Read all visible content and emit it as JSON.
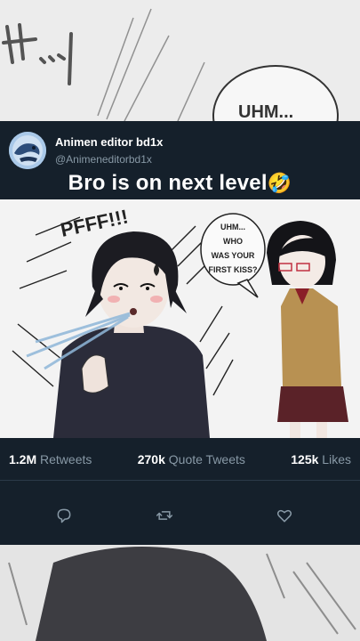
{
  "tweet": {
    "display_name": "Animen editor bd1x",
    "handle": "@Animeneditorbd1x",
    "caption": "Bro is on next level",
    "caption_emoji": "🤣"
  },
  "media": {
    "sfx_top": "PFFF!!!",
    "speech_bubble": [
      "UHM...",
      "WHO",
      "WAS YOUR",
      "FIRST KISS?"
    ],
    "bg_bubble": "UHM..."
  },
  "stats": {
    "retweets_count": "1.2M",
    "retweets_label": "Retweets",
    "quote_count": "270k",
    "quote_label": "Quote Tweets",
    "likes_count": "125k",
    "likes_label": "Likes"
  },
  "colors": {
    "card_bg": "#15202b",
    "muted_text": "#8899a6",
    "divider": "#2b3a48"
  },
  "icons": {
    "reply": "reply-icon",
    "retweet": "retweet-icon",
    "like": "like-icon"
  }
}
